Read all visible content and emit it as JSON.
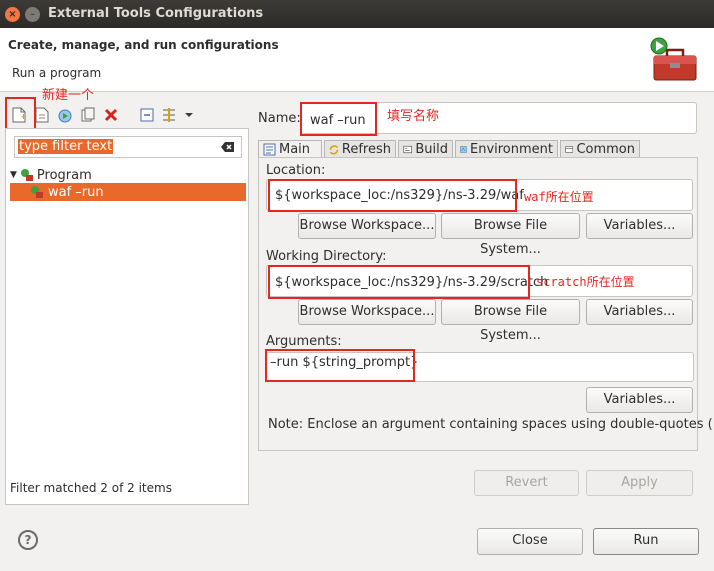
{
  "window": {
    "title": "External Tools Configurations"
  },
  "header": {
    "title": "Create, manage, and run configurations",
    "subtitle": "Run a program"
  },
  "annotations": {
    "new_config": "新建一个",
    "name_hint": "填写名称",
    "waf_location": "waf所在位置",
    "scratch_location": "scratch所在位置"
  },
  "toolbar": {
    "icons": [
      "new-config-icon",
      "new-prototype-icon",
      "duplicate-icon",
      "export-icon",
      "delete-icon",
      "collapse-all-icon",
      "filter-icon",
      "view-menu-icon"
    ]
  },
  "sidebar": {
    "filter_placeholder": "type filter text",
    "tree": {
      "category": "Program",
      "items": [
        {
          "label": "waf –run"
        }
      ]
    },
    "status": "Filter matched 2 of 2 items"
  },
  "config": {
    "name_label": "Name:",
    "name_value": "waf –run",
    "tabs": [
      {
        "label": "Main"
      },
      {
        "label": "Refresh"
      },
      {
        "label": "Build"
      },
      {
        "label": "Environment"
      },
      {
        "label": "Common"
      }
    ],
    "location": {
      "label": "Location:",
      "value": "${workspace_loc:/ns329}/ns-3.29/waf",
      "buttons": [
        "Browse Workspace...",
        "Browse File System...",
        "Variables..."
      ]
    },
    "working_dir": {
      "label": "Working Directory:",
      "value": "${workspace_loc:/ns329}/ns-3.29/scratch",
      "buttons": [
        "Browse Workspace...",
        "Browse File System...",
        "Variables..."
      ]
    },
    "arguments": {
      "label": "Arguments:",
      "value": "–run ${string_prompt}",
      "variables_button": "Variables...",
      "note": "Note: Enclose an argument containing spaces using double-quotes (\")."
    },
    "revert_label": "Revert",
    "apply_label": "Apply"
  },
  "footer": {
    "help": "?",
    "close_label": "Close",
    "run_label": "Run"
  },
  "colors": {
    "accent": "#e8692a",
    "annotation": "#e5281e",
    "titlebar": "#3c3b37"
  }
}
